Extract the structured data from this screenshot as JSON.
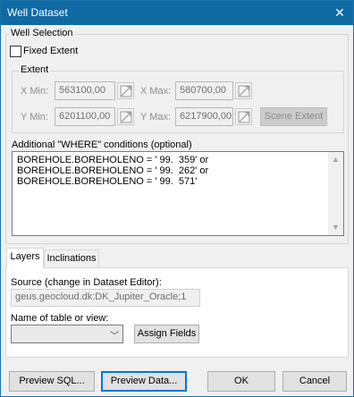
{
  "window": {
    "title": "Well Dataset"
  },
  "well_selection": {
    "legend": "Well Selection",
    "fixed_extent_label": "Fixed Extent",
    "fixed_extent_checked": false,
    "extent": {
      "legend": "Extent",
      "x_min_label": "X Min:",
      "x_min_value": "563100,00",
      "x_max_label": "X Max:",
      "x_max_value": "580700,00",
      "y_min_label": "Y Min:",
      "y_min_value": "6201100,00",
      "y_max_label": "Y Max:",
      "y_max_value": "6217900,00",
      "scene_extent_label": "Scene Extent"
    },
    "where_label": "Additional \"WHERE\" conditions (optional)",
    "where_lines": [
      "BOREHOLE.BOREHOLENO = ' 99.  359' or",
      "BOREHOLE.BOREHOLENO = ' 99.  262' or",
      "BOREHOLE.BOREHOLENO = ' 99.  571'"
    ]
  },
  "tabs": [
    {
      "label": "Layers",
      "active": true
    },
    {
      "label": "Inclinations",
      "active": false
    }
  ],
  "layers": {
    "source_label": "Source (change in Dataset Editor):",
    "source_value": "geus.geocloud.dk:DK_Jupiter_Oracle;1",
    "table_label": "Name of table or view:",
    "table_value": "",
    "assign_fields_label": "Assign Fields"
  },
  "buttons": {
    "preview_sql": "Preview SQL...",
    "preview_data": "Preview Data...",
    "ok": "OK",
    "cancel": "Cancel"
  },
  "icons": {
    "close": "close-icon",
    "spin": "pick-coordinate-icon",
    "scroll_up": "scroll-up-arrow",
    "scroll_down": "scroll-down-arrow",
    "dropdown": "chevron-down-icon"
  }
}
